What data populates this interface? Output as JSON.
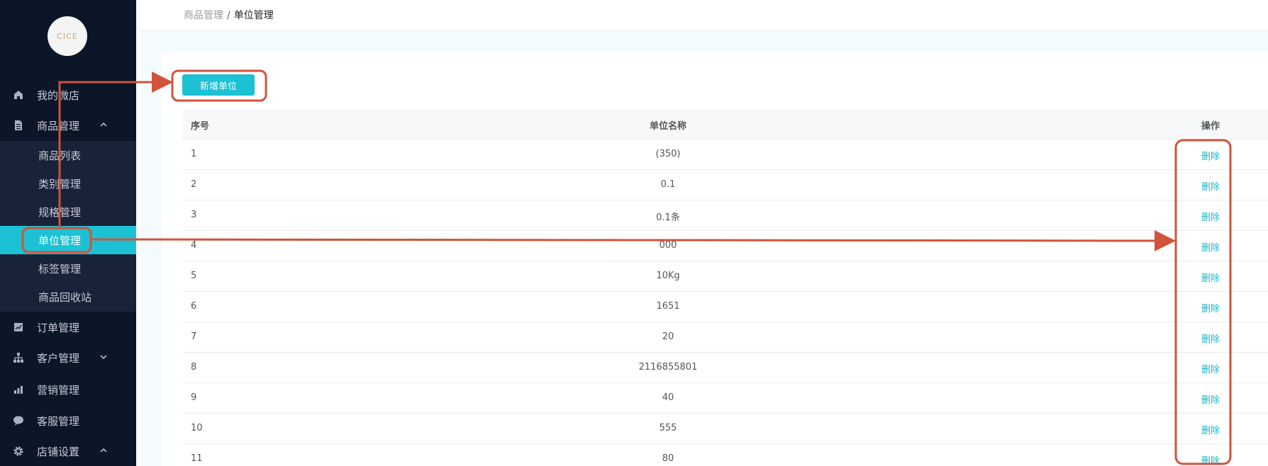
{
  "sidebar": {
    "logo_text": "CICE",
    "items": [
      {
        "label": "我的微店",
        "icon": "home-icon"
      },
      {
        "label": "商品管理",
        "icon": "document-icon",
        "arrow": "chevron-up-icon"
      },
      {
        "label": "订单管理",
        "icon": "chart-icon"
      },
      {
        "label": "客户管理",
        "icon": "org-icon",
        "arrow": "chevron-down-icon"
      },
      {
        "label": "营销管理",
        "icon": "bar-chart-icon"
      },
      {
        "label": "客服管理",
        "icon": "chat-icon"
      },
      {
        "label": "店铺设置",
        "icon": "gear-icon",
        "arrow": "chevron-up-icon"
      }
    ],
    "subitems": [
      {
        "label": "商品列表"
      },
      {
        "label": "类别管理"
      },
      {
        "label": "规格管理"
      },
      {
        "label": "单位管理",
        "active": true
      },
      {
        "label": "标签管理"
      },
      {
        "label": "商品回收站"
      }
    ]
  },
  "breadcrumb": {
    "parent": "商品管理",
    "separator": "/",
    "current": "单位管理"
  },
  "toolbar": {
    "add_label": "新增单位"
  },
  "table": {
    "headers": {
      "index": "序号",
      "name": "单位名称",
      "action": "操作"
    },
    "action_label": "删除",
    "rows": [
      {
        "index": "1",
        "name": "(350)"
      },
      {
        "index": "2",
        "name": "0.1"
      },
      {
        "index": "3",
        "name": "0.1条"
      },
      {
        "index": "4",
        "name": "000"
      },
      {
        "index": "5",
        "name": "10Kg"
      },
      {
        "index": "6",
        "name": "1651"
      },
      {
        "index": "7",
        "name": "20"
      },
      {
        "index": "8",
        "name": "2116855801"
      },
      {
        "index": "9",
        "name": "40"
      },
      {
        "index": "10",
        "name": "555"
      },
      {
        "index": "11",
        "name": "80"
      }
    ]
  },
  "colors": {
    "sidebar_bg": "#0c1629",
    "accent": "#1cc1d3",
    "annotation": "#d0533a"
  }
}
